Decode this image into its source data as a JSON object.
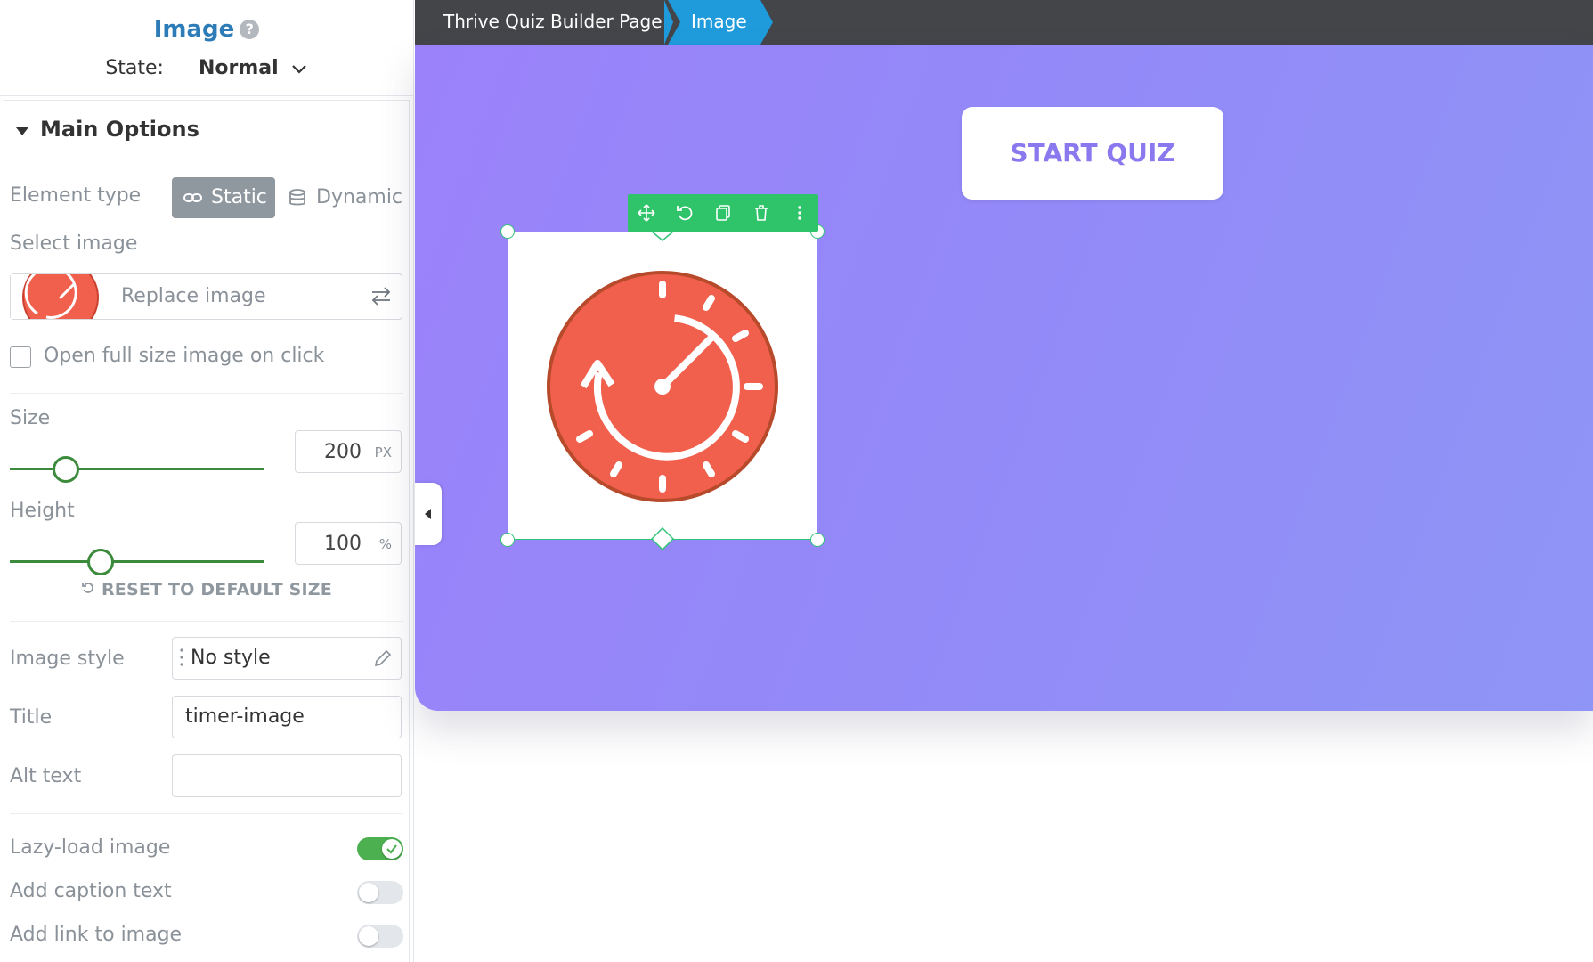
{
  "panel": {
    "title": "Image",
    "help_icon": "help-icon",
    "state_label": "State:",
    "state_value": "Normal"
  },
  "main_options": {
    "section_label": "Main Options",
    "element_type_label": "Element type",
    "static_label": "Static",
    "dynamic_label": "Dynamic",
    "select_image_label": "Select image",
    "replace_image_label": "Replace image",
    "open_full_size_label": "Open full size image on click",
    "open_full_size_checked": false,
    "size_label": "Size",
    "size_value": "200",
    "size_unit": "PX",
    "height_label": "Height",
    "height_value": "100",
    "height_unit": "%",
    "reset_label": "RESET TO DEFAULT SIZE",
    "image_style_label": "Image style",
    "image_style_value": "No style",
    "title_label": "Title",
    "title_value": "timer-image",
    "alt_text_label": "Alt text",
    "alt_text_value": "",
    "lazy_load_label": "Lazy-load image",
    "lazy_load_on": true,
    "caption_label": "Add caption text",
    "caption_on": false,
    "link_label": "Add link to image",
    "link_on": false
  },
  "breadcrumb": {
    "page": "Thrive Quiz Builder Page",
    "current": "Image"
  },
  "canvas": {
    "start_quiz_label": "START QUIZ"
  },
  "colors": {
    "accent_blue": "#2d7cb7",
    "selection_green": "#2fc469",
    "breadcrumb_active": "#1f9bdc",
    "hero_gradient_start": "#9b82fb",
    "hero_gradient_end": "#8f95f6",
    "timer_red": "#f0604d"
  }
}
